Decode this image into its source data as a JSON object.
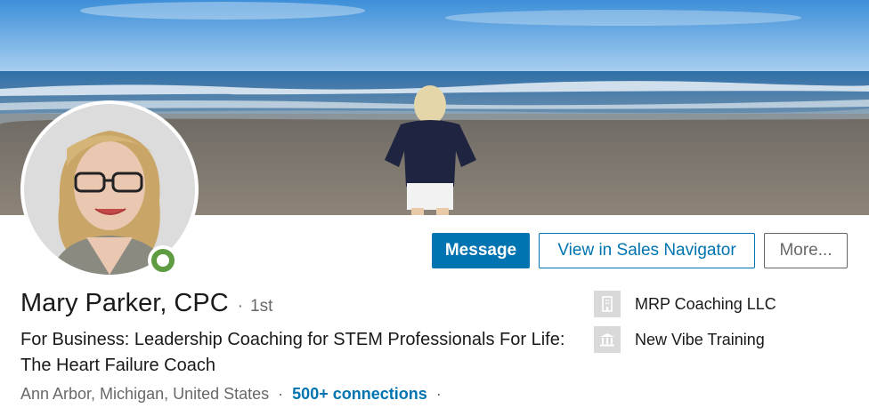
{
  "profile": {
    "name": "Mary Parker, CPC",
    "degree_separator": "·",
    "degree": "1st",
    "headline": "For Business: Leadership Coaching for STEM Professionals For Life: The Heart Failure Coach",
    "location": "Ann Arbor, Michigan, United States",
    "meta_separator": "·",
    "connections": "500+ connections",
    "trailing_separator": "·",
    "online_status": "online"
  },
  "actions": {
    "message_label": "Message",
    "sales_navigator_label": "View in Sales Navigator",
    "more_label": "More..."
  },
  "organizations": [
    {
      "label": "MRP Coaching LLC",
      "icon": "company-building-icon"
    },
    {
      "label": "New Vibe Training",
      "icon": "school-icon"
    }
  ],
  "colors": {
    "primary": "#0073b1",
    "online": "#5f9b41",
    "text_muted": "#666666"
  }
}
